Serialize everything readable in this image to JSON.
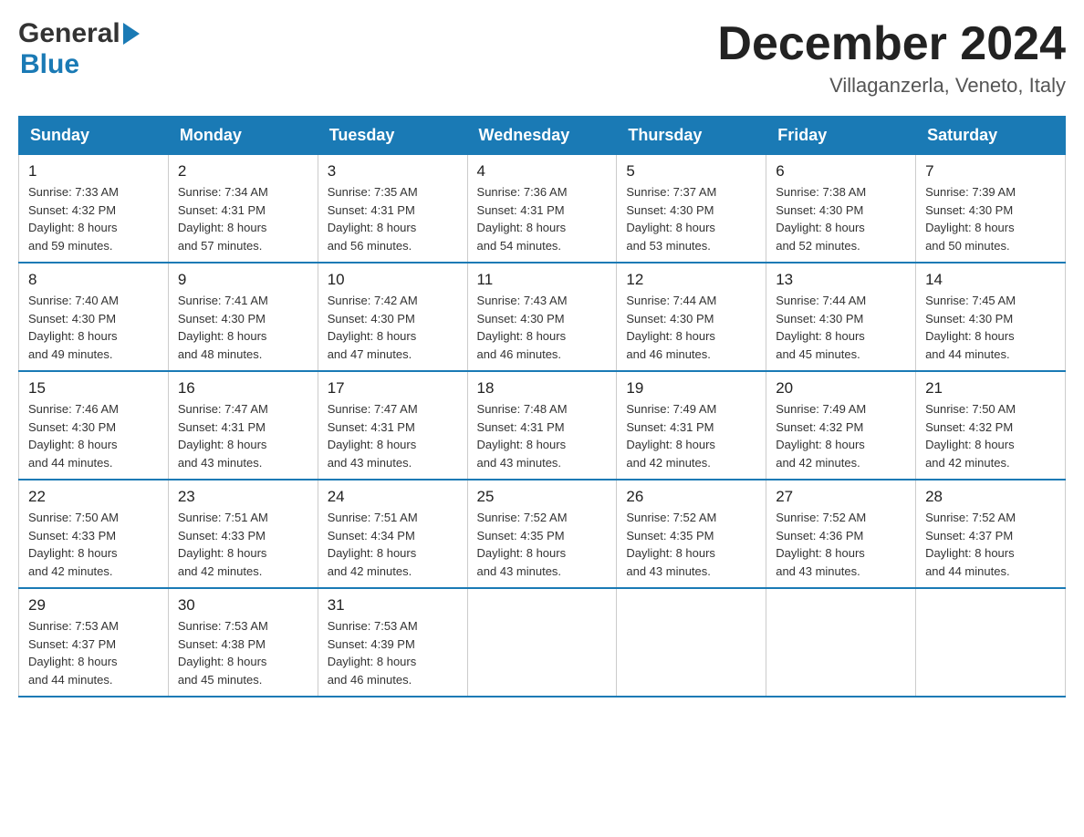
{
  "header": {
    "logo": {
      "part1": "General",
      "part2": "Blue"
    },
    "title": "December 2024",
    "location": "Villaganzerla, Veneto, Italy"
  },
  "days_of_week": [
    "Sunday",
    "Monday",
    "Tuesday",
    "Wednesday",
    "Thursday",
    "Friday",
    "Saturday"
  ],
  "weeks": [
    [
      {
        "day": "1",
        "sunrise": "7:33 AM",
        "sunset": "4:32 PM",
        "daylight": "8 hours and 59 minutes."
      },
      {
        "day": "2",
        "sunrise": "7:34 AM",
        "sunset": "4:31 PM",
        "daylight": "8 hours and 57 minutes."
      },
      {
        "day": "3",
        "sunrise": "7:35 AM",
        "sunset": "4:31 PM",
        "daylight": "8 hours and 56 minutes."
      },
      {
        "day": "4",
        "sunrise": "7:36 AM",
        "sunset": "4:31 PM",
        "daylight": "8 hours and 54 minutes."
      },
      {
        "day": "5",
        "sunrise": "7:37 AM",
        "sunset": "4:30 PM",
        "daylight": "8 hours and 53 minutes."
      },
      {
        "day": "6",
        "sunrise": "7:38 AM",
        "sunset": "4:30 PM",
        "daylight": "8 hours and 52 minutes."
      },
      {
        "day": "7",
        "sunrise": "7:39 AM",
        "sunset": "4:30 PM",
        "daylight": "8 hours and 50 minutes."
      }
    ],
    [
      {
        "day": "8",
        "sunrise": "7:40 AM",
        "sunset": "4:30 PM",
        "daylight": "8 hours and 49 minutes."
      },
      {
        "day": "9",
        "sunrise": "7:41 AM",
        "sunset": "4:30 PM",
        "daylight": "8 hours and 48 minutes."
      },
      {
        "day": "10",
        "sunrise": "7:42 AM",
        "sunset": "4:30 PM",
        "daylight": "8 hours and 47 minutes."
      },
      {
        "day": "11",
        "sunrise": "7:43 AM",
        "sunset": "4:30 PM",
        "daylight": "8 hours and 46 minutes."
      },
      {
        "day": "12",
        "sunrise": "7:44 AM",
        "sunset": "4:30 PM",
        "daylight": "8 hours and 46 minutes."
      },
      {
        "day": "13",
        "sunrise": "7:44 AM",
        "sunset": "4:30 PM",
        "daylight": "8 hours and 45 minutes."
      },
      {
        "day": "14",
        "sunrise": "7:45 AM",
        "sunset": "4:30 PM",
        "daylight": "8 hours and 44 minutes."
      }
    ],
    [
      {
        "day": "15",
        "sunrise": "7:46 AM",
        "sunset": "4:30 PM",
        "daylight": "8 hours and 44 minutes."
      },
      {
        "day": "16",
        "sunrise": "7:47 AM",
        "sunset": "4:31 PM",
        "daylight": "8 hours and 43 minutes."
      },
      {
        "day": "17",
        "sunrise": "7:47 AM",
        "sunset": "4:31 PM",
        "daylight": "8 hours and 43 minutes."
      },
      {
        "day": "18",
        "sunrise": "7:48 AM",
        "sunset": "4:31 PM",
        "daylight": "8 hours and 43 minutes."
      },
      {
        "day": "19",
        "sunrise": "7:49 AM",
        "sunset": "4:31 PM",
        "daylight": "8 hours and 42 minutes."
      },
      {
        "day": "20",
        "sunrise": "7:49 AM",
        "sunset": "4:32 PM",
        "daylight": "8 hours and 42 minutes."
      },
      {
        "day": "21",
        "sunrise": "7:50 AM",
        "sunset": "4:32 PM",
        "daylight": "8 hours and 42 minutes."
      }
    ],
    [
      {
        "day": "22",
        "sunrise": "7:50 AM",
        "sunset": "4:33 PM",
        "daylight": "8 hours and 42 minutes."
      },
      {
        "day": "23",
        "sunrise": "7:51 AM",
        "sunset": "4:33 PM",
        "daylight": "8 hours and 42 minutes."
      },
      {
        "day": "24",
        "sunrise": "7:51 AM",
        "sunset": "4:34 PM",
        "daylight": "8 hours and 42 minutes."
      },
      {
        "day": "25",
        "sunrise": "7:52 AM",
        "sunset": "4:35 PM",
        "daylight": "8 hours and 43 minutes."
      },
      {
        "day": "26",
        "sunrise": "7:52 AM",
        "sunset": "4:35 PM",
        "daylight": "8 hours and 43 minutes."
      },
      {
        "day": "27",
        "sunrise": "7:52 AM",
        "sunset": "4:36 PM",
        "daylight": "8 hours and 43 minutes."
      },
      {
        "day": "28",
        "sunrise": "7:52 AM",
        "sunset": "4:37 PM",
        "daylight": "8 hours and 44 minutes."
      }
    ],
    [
      {
        "day": "29",
        "sunrise": "7:53 AM",
        "sunset": "4:37 PM",
        "daylight": "8 hours and 44 minutes."
      },
      {
        "day": "30",
        "sunrise": "7:53 AM",
        "sunset": "4:38 PM",
        "daylight": "8 hours and 45 minutes."
      },
      {
        "day": "31",
        "sunrise": "7:53 AM",
        "sunset": "4:39 PM",
        "daylight": "8 hours and 46 minutes."
      },
      null,
      null,
      null,
      null
    ]
  ],
  "labels": {
    "sunrise": "Sunrise:",
    "sunset": "Sunset:",
    "daylight": "Daylight:"
  }
}
